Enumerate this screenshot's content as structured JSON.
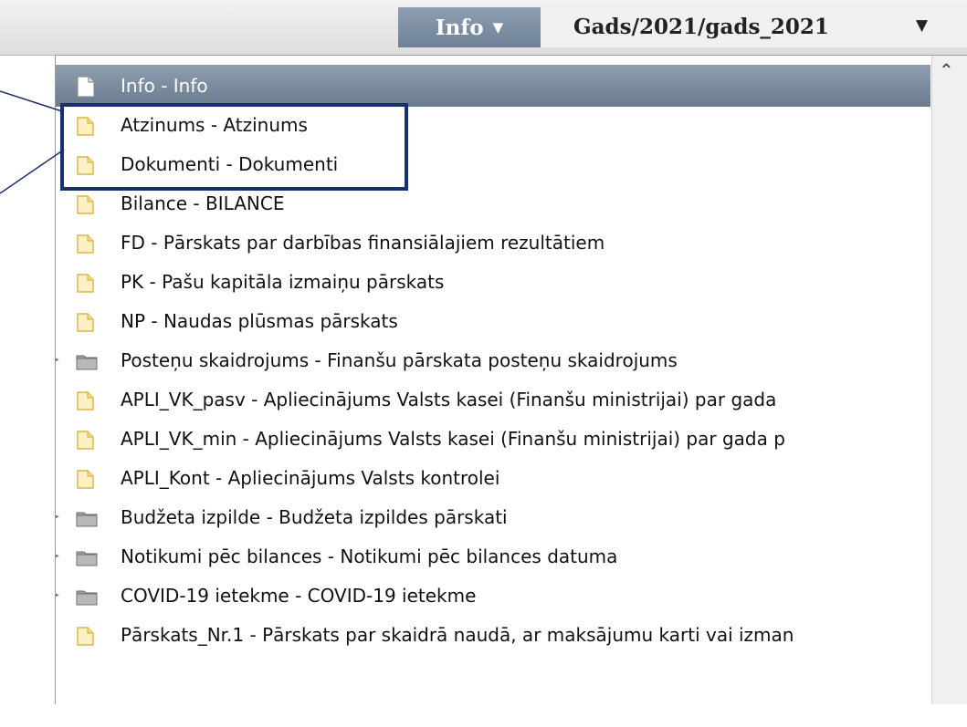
{
  "toolbar": {
    "info_label": "Info",
    "year_value": "Gads/2021/gads_2021",
    "dropdown_icon": "triangle-down-icon"
  },
  "tree": {
    "rows": [
      {
        "label": "Info - Info",
        "icon": "file-icon",
        "selected": true,
        "expandable": false
      },
      {
        "label": "Atzinums - Atzinums",
        "icon": "folder-icon",
        "selected": false,
        "expandable": false
      },
      {
        "label": "Dokumenti - Dokumenti",
        "icon": "folder-icon",
        "selected": false,
        "expandable": false
      },
      {
        "label": "Bilance - BILANCE",
        "icon": "folder-icon",
        "selected": false,
        "expandable": false
      },
      {
        "label": "FD - Pārskats par darbības finansiālajiem rezultātiem",
        "icon": "folder-icon",
        "selected": false,
        "expandable": false
      },
      {
        "label": "PK - Pašu kapitāla izmaiņu pārskats",
        "icon": "folder-icon",
        "selected": false,
        "expandable": false
      },
      {
        "label": "NP - Naudas plūsmas pārskats",
        "icon": "folder-icon",
        "selected": false,
        "expandable": false
      },
      {
        "label": "Posteņu skaidrojums - Finanšu pārskata posteņu skaidrojums",
        "icon": "grey-folder-icon",
        "selected": false,
        "expandable": true
      },
      {
        "label": "APLI_VK_pasv - Apliecinājums Valsts kasei (Finanšu ministrijai) par gada",
        "icon": "folder-icon",
        "selected": false,
        "expandable": false
      },
      {
        "label": "APLI_VK_min - Apliecinājums Valsts kasei (Finanšu ministrijai) par gada p",
        "icon": "folder-icon",
        "selected": false,
        "expandable": false
      },
      {
        "label": "APLI_Kont - Apliecinājums Valsts kontrolei",
        "icon": "folder-icon",
        "selected": false,
        "expandable": false
      },
      {
        "label": "Budžeta izpilde - Budžeta izpildes pārskati",
        "icon": "grey-folder-icon",
        "selected": false,
        "expandable": true
      },
      {
        "label": "Notikumi pēc bilances - Notikumi pēc bilances datuma",
        "icon": "grey-folder-icon",
        "selected": false,
        "expandable": true
      },
      {
        "label": "COVID-19 ietekme - COVID-19 ietekme",
        "icon": "grey-folder-icon",
        "selected": false,
        "expandable": true
      },
      {
        "label": "Pārskats_Nr.1 - Pārskats par skaidrā naudā, ar maksājumu karti vai izman",
        "icon": "folder-icon",
        "selected": false,
        "expandable": false
      }
    ]
  },
  "colors": {
    "selected_row": "#7d8da1",
    "highlight_border": "#18306d",
    "folder_fill": "#fdf0c2",
    "folder_stroke": "#d9b54a"
  }
}
